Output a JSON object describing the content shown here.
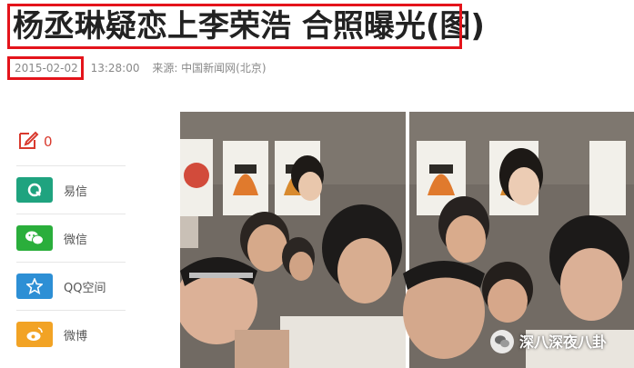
{
  "article": {
    "title": "杨丞琳疑恋上李荣浩 合照曝光(图)",
    "date": "2015-02-02",
    "time": "13:28:00",
    "source": "来源: 中国新闻网(北京)"
  },
  "share": {
    "comment_count": "0",
    "items": [
      {
        "label": "易信",
        "icon": "yixin-icon",
        "color": "#1fa37f"
      },
      {
        "label": "微信",
        "icon": "wechat-icon",
        "color": "#2aae3b"
      },
      {
        "label": "QQ空间",
        "icon": "qzone-icon",
        "color": "#2d8fd5"
      },
      {
        "label": "微博",
        "icon": "weibo-icon",
        "color": "#f2a325"
      }
    ]
  },
  "photo": {
    "watermark": "深八深夜八卦"
  },
  "colors": {
    "highlight": "#e4141b",
    "comment": "#d93a2e"
  }
}
